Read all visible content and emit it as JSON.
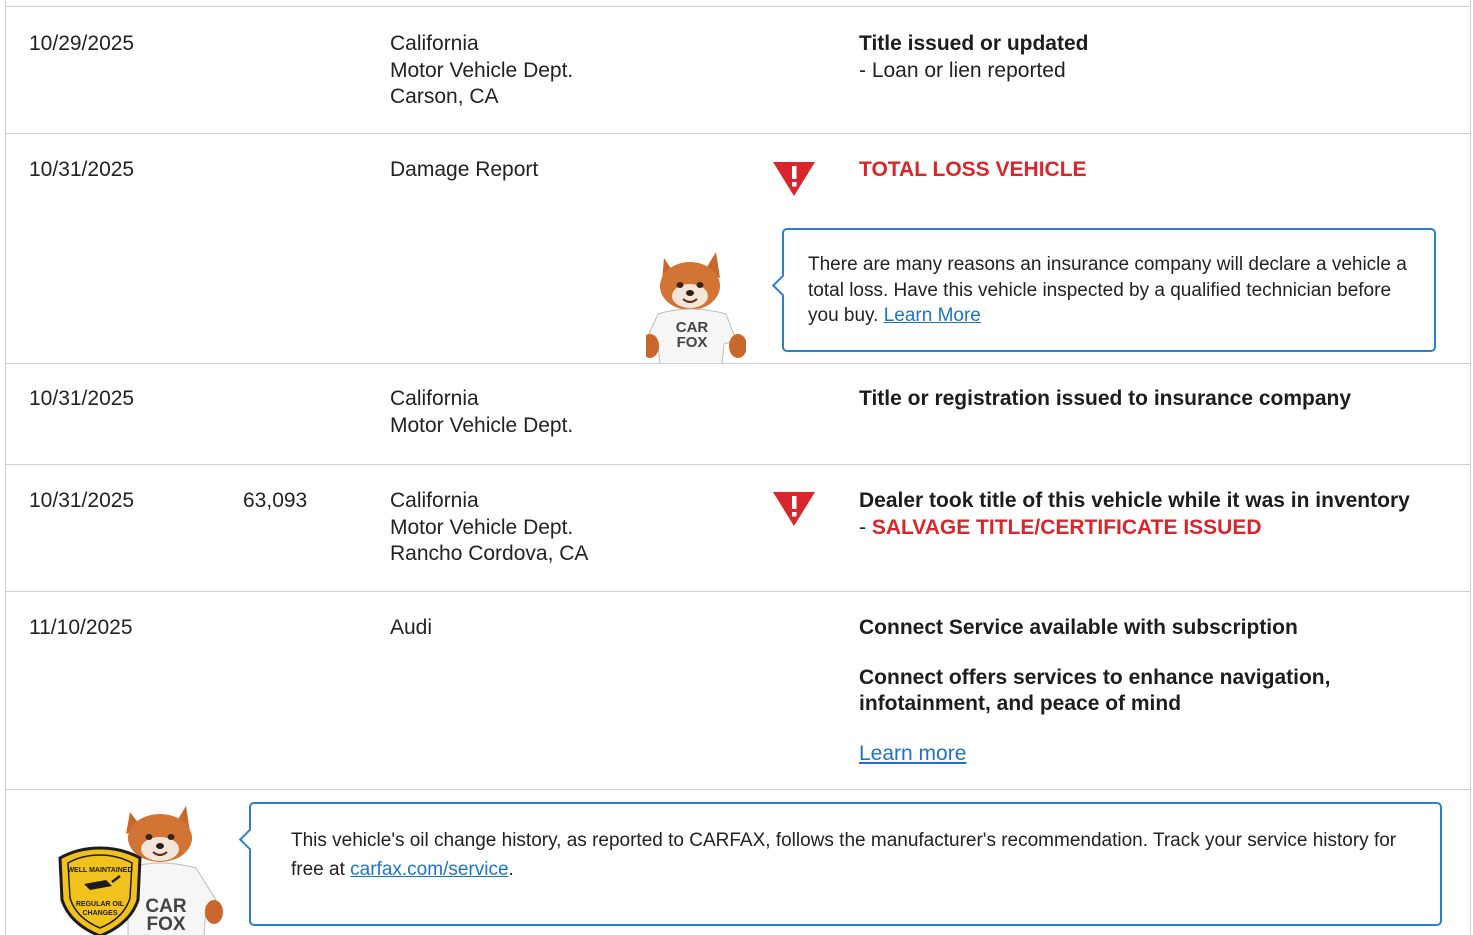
{
  "records": [
    {
      "date": "10/29/2025",
      "odometer": "",
      "source": [
        "California",
        "Motor Vehicle Dept.",
        "Carson, CA"
      ],
      "title": "Title issued or updated",
      "detail": "- Loan or lien reported"
    },
    {
      "date": "10/31/2025",
      "odometer": "",
      "source": [
        "Damage Report"
      ],
      "title": "TOTAL LOSS VEHICLE",
      "alert": true,
      "callout": {
        "text": "There are many reasons an insurance company will declare a vehicle a total loss. Have this vehicle inspected by a qualified technician before you buy.",
        "link": "Learn More"
      }
    },
    {
      "date": "10/31/2025",
      "odometer": "",
      "source": [
        "California",
        "Motor Vehicle Dept."
      ],
      "title": "Title or registration issued to insurance company"
    },
    {
      "date": "10/31/2025",
      "odometer": "63,093",
      "source": [
        "California",
        "Motor Vehicle Dept.",
        "Rancho Cordova, CA"
      ],
      "title": "Dealer took title of this vehicle while it was in inventory",
      "detail_prefix": "- ",
      "detail_red": "SALVAGE TITLE/CERTIFICATE ISSUED",
      "alert": true
    },
    {
      "date": "11/10/2025",
      "odometer": "",
      "source": [
        "Audi"
      ],
      "title": "Connect Service available with subscription",
      "title2_line1": "Connect offers services to enhance navigation,",
      "title2_line2": "infotainment, and peace of mind",
      "link": "Learn more"
    }
  ],
  "footer": {
    "text_before": "This vehicle's oil change history, as reported to CARFAX, follows the manufacturer's recommendation. Track your service history for free at ",
    "link": "carfax.com/service",
    "text_after": ".",
    "badge_top": "WELL MAINTAINED",
    "badge_bottom_1": "REGULAR OIL",
    "badge_bottom_2": "CHANGES"
  },
  "mascot": {
    "shirt_line1": "CAR",
    "shirt_line2": "FOX"
  },
  "colors": {
    "alert_red": "#d8262c",
    "link_blue": "#1d74c6",
    "callout_border": "#2c7fd0",
    "divider": "#cfcfcf"
  }
}
